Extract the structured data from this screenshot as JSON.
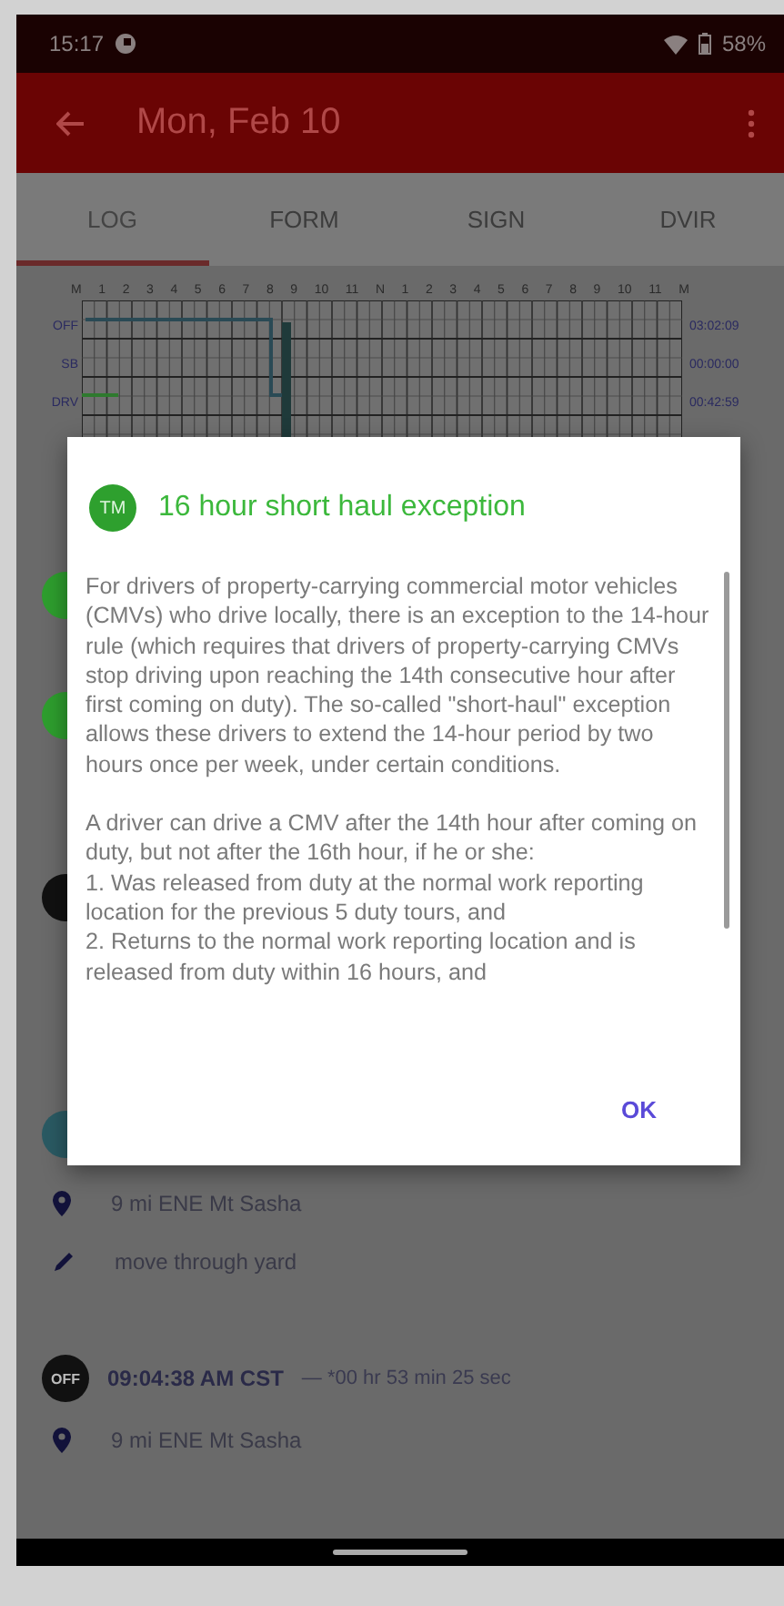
{
  "status_bar": {
    "time": "15:17",
    "battery": "58%"
  },
  "app_bar": {
    "title": "Mon, Feb 10"
  },
  "tabs": [
    {
      "label": "LOG",
      "selected": true
    },
    {
      "label": "FORM",
      "selected": false
    },
    {
      "label": "SIGN",
      "selected": false
    },
    {
      "label": "DVIR",
      "selected": false
    }
  ],
  "log_grid": {
    "hours": [
      "M",
      "1",
      "2",
      "3",
      "4",
      "5",
      "6",
      "7",
      "8",
      "9",
      "10",
      "11",
      "N",
      "1",
      "2",
      "3",
      "4",
      "5",
      "6",
      "7",
      "8",
      "9",
      "10",
      "11",
      "M"
    ],
    "rows": [
      {
        "label": "OFF",
        "total": "03:02:09"
      },
      {
        "label": "SB",
        "total": "00:00:00"
      },
      {
        "label": "DRV",
        "total": "00:42:59"
      }
    ]
  },
  "events": [
    {
      "kind": "status",
      "color": "#2e9e2e"
    },
    {
      "kind": "status",
      "color": "#2e9e2e"
    },
    {
      "kind": "status",
      "color": "#111111"
    },
    {
      "kind": "status",
      "color": "#2a5a63"
    },
    {
      "kind": "location",
      "text": "9 mi ENE Mt Sasha"
    },
    {
      "kind": "note",
      "text": "move through yard"
    },
    {
      "kind": "status",
      "color": "#111111",
      "code": "OFF",
      "time": "09:04:38 AM CST",
      "duration": "— *00 hr 53 min 25 sec"
    },
    {
      "kind": "location",
      "text": "9 mi ENE Mt Sasha"
    }
  ],
  "dialog": {
    "avatar": "TM",
    "title": "16 hour short haul exception",
    "paragraphs": [
      "For drivers of property-carrying commercial motor vehicles (CMVs) who drive locally, there is an exception to the 14-hour rule (which requires that drivers of property-carrying CMVs stop driving upon reaching the 14th consecutive hour after first coming on duty). The so-called \"short-haul\" exception allows these drivers to extend the 14-hour period by two hours once per week, under certain conditions.",
      "A driver can drive a CMV after the 14th hour after coming on duty, but not after the 16th hour, if he or she:\n1. Was released from duty at the normal work reporting location for the previous 5 duty tours, and\n2. Returns to the normal work reporting location and is released from duty within 16 hours, and"
    ],
    "button": "OK"
  }
}
